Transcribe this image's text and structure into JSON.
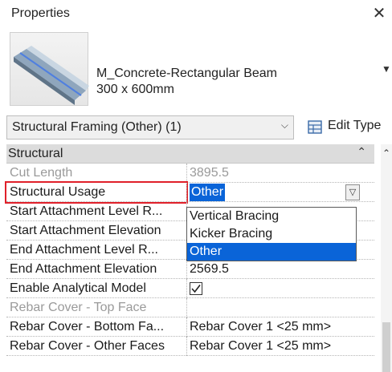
{
  "panel": {
    "title": "Properties",
    "close_glyph": "✕"
  },
  "type_selector": {
    "family": "M_Concrete-Rectangular Beam",
    "type": "300 x 600mm",
    "arrow_glyph": "▼"
  },
  "filter": {
    "value": "Structural Framing (Other) (1)",
    "chevron_glyph": "⌵",
    "edit_type_label": "Edit Type"
  },
  "section": {
    "label": "Structural",
    "collapse_glyph": "⌃"
  },
  "rows": [
    {
      "name": "Cut Length",
      "value": "3895.5",
      "disabled": true
    },
    {
      "name": "Structural Usage",
      "value": "Other",
      "highlighted": true
    },
    {
      "name": "Start Attachment Level R...",
      "value": ""
    },
    {
      "name": "Start Attachment Elevation",
      "value": ""
    },
    {
      "name": "End Attachment Level R...",
      "value": ""
    },
    {
      "name": "End Attachment Elevation",
      "value": "2569.5"
    },
    {
      "name": "Enable Analytical Model",
      "value": "",
      "checked": true
    },
    {
      "name": "Rebar Cover - Top Face",
      "value": "",
      "disabled": true
    },
    {
      "name": "Rebar Cover - Bottom Fa...",
      "value": "Rebar Cover 1 <25 mm>"
    },
    {
      "name": "Rebar Cover - Other Faces",
      "value": "Rebar Cover 1 <25 mm>"
    }
  ],
  "dropdown": {
    "options": [
      "Vertical Bracing",
      "Kicker Bracing",
      "Other"
    ],
    "selected": "Other"
  },
  "colors": {
    "highlight_border": "#e0202a",
    "selection": "#0a64d8",
    "section_bg": "#dcdcdc"
  }
}
